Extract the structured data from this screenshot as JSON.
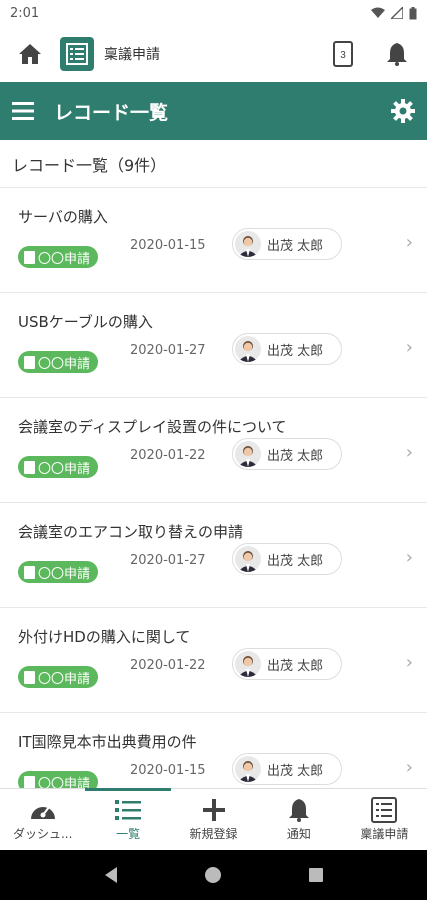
{
  "status": {
    "time": "2:01"
  },
  "header": {
    "app_title": "稟議申請",
    "notebook_count": "3"
  },
  "titlebar": {
    "title": "レコード一覧"
  },
  "list_header": {
    "count_label": "レコード一覧（9件）"
  },
  "items": [
    {
      "name": "サーバの購入",
      "badge": "〇〇申請",
      "date": "2020-01-15",
      "user": "出茂 太郎"
    },
    {
      "name": "USBケーブルの購入",
      "badge": "〇〇申請",
      "date": "2020-01-27",
      "user": "出茂 太郎"
    },
    {
      "name": "会議室のディスプレイ設置の件について",
      "badge": "〇〇申請",
      "date": "2020-01-22",
      "user": "出茂 太郎"
    },
    {
      "name": "会議室のエアコン取り替えの申請",
      "badge": "〇〇申請",
      "date": "2020-01-27",
      "user": "出茂 太郎"
    },
    {
      "name": "外付けHDの購入に関して",
      "badge": "〇〇申請",
      "date": "2020-01-22",
      "user": "出茂 太郎"
    },
    {
      "name": "IT国際見本市出典費用の件",
      "badge": "〇〇申請",
      "date": "2020-01-15",
      "user": "出茂 太郎"
    }
  ],
  "bottom_nav": [
    {
      "label": "ダッシュ...",
      "icon": "dashboard-icon"
    },
    {
      "label": "一覧",
      "icon": "list-icon"
    },
    {
      "label": "新規登録",
      "icon": "plus-icon"
    },
    {
      "label": "通知",
      "icon": "bell-icon"
    },
    {
      "label": "稟議申請",
      "icon": "app-icon"
    }
  ],
  "colors": {
    "accent": "#2e7d6e",
    "badge": "#5cb85c"
  }
}
